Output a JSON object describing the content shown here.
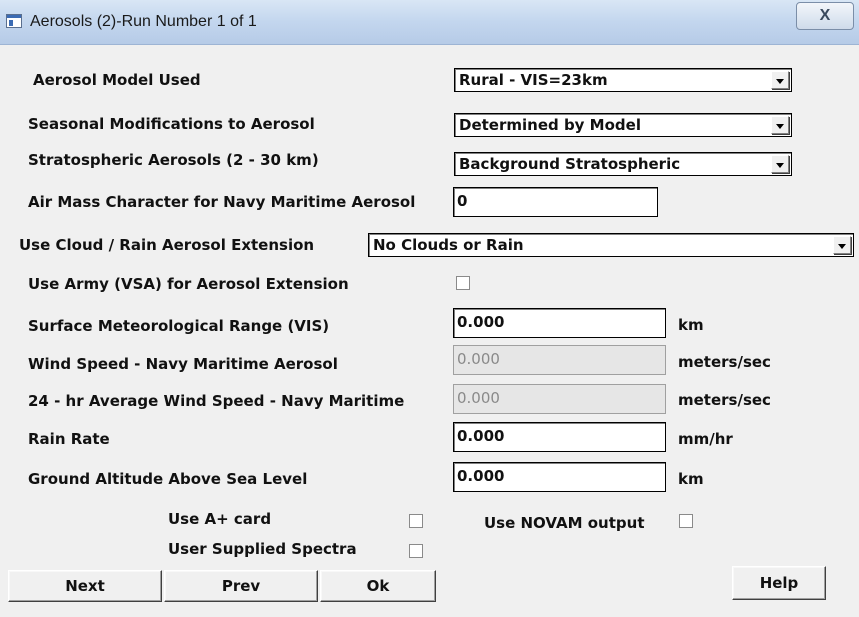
{
  "window": {
    "title": "Aerosols (2)-Run Number  1 of  1",
    "close_label": "X"
  },
  "fields": {
    "aerosol_model": {
      "label": "Aerosol Model Used",
      "value": "Rural - VIS=23km"
    },
    "seasonal": {
      "label": "Seasonal Modifications to Aerosol",
      "value": "Determined by Model"
    },
    "strato": {
      "label": "Stratospheric Aerosols (2 - 30 km)",
      "value": "Background Stratospheric"
    },
    "air_mass": {
      "label": "Air Mass Character for Navy Maritime Aerosol",
      "value": "0"
    },
    "cloud_rain": {
      "label": "Use Cloud / Rain Aerosol Extension",
      "value": "No Clouds or Rain"
    },
    "army_vsa": {
      "label": "Use Army (VSA) for Aerosol Extension"
    },
    "vis": {
      "label": "Surface Meteorological Range (VIS)",
      "value": "0.000",
      "unit": "km"
    },
    "wind_speed": {
      "label": "Wind Speed - Navy Maritime Aerosol",
      "value": "0.000",
      "unit": "meters/sec"
    },
    "wind_avg": {
      "label": "24 - hr Average Wind Speed - Navy Maritime",
      "value": "0.000",
      "unit": "meters/sec"
    },
    "rain_rate": {
      "label": "Rain Rate",
      "value": "0.000",
      "unit": "mm/hr"
    },
    "ground_alt": {
      "label": "Ground Altitude Above Sea Level",
      "value": "0.000",
      "unit": "km"
    }
  },
  "options": {
    "a_plus": "Use A+ card",
    "novam": "Use NOVAM output",
    "user_spectra": "User Supplied Spectra"
  },
  "buttons": {
    "next": "Next",
    "prev": "Prev",
    "ok": "Ok",
    "help": "Help"
  }
}
